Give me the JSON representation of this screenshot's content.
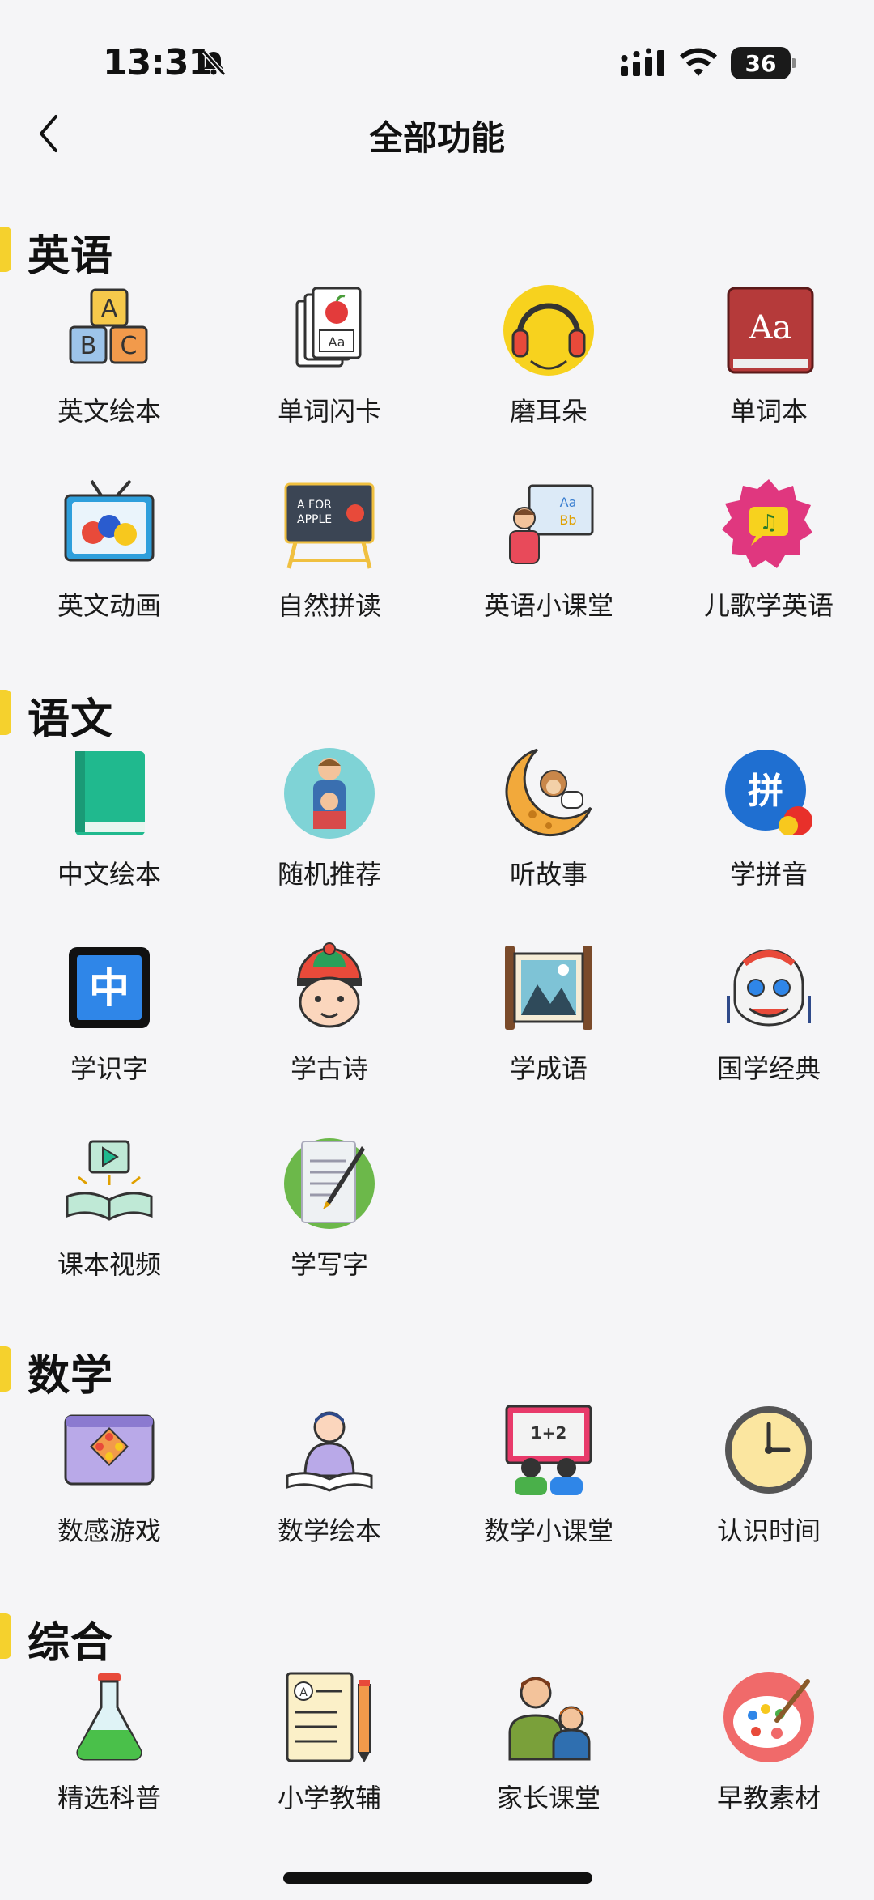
{
  "status_bar": {
    "time": "13:31",
    "battery": "36"
  },
  "nav": {
    "title": "全部功能"
  },
  "sections": {
    "english": {
      "title": "英语",
      "items": [
        {
          "label": "英文绘本",
          "icon": "abc-blocks-icon"
        },
        {
          "label": "单词闪卡",
          "icon": "flashcard-icon"
        },
        {
          "label": "磨耳朵",
          "icon": "headphones-icon"
        },
        {
          "label": "单词本",
          "icon": "dictionary-book-icon"
        },
        {
          "label": "英文动画",
          "icon": "tv-icon"
        },
        {
          "label": "自然拼读",
          "icon": "easel-board-icon"
        },
        {
          "label": "英语小课堂",
          "icon": "teacher-board-icon"
        },
        {
          "label": "儿歌学英语",
          "icon": "music-badge-icon"
        }
      ]
    },
    "chinese": {
      "title": "语文",
      "items": [
        {
          "label": "中文绘本",
          "icon": "green-book-icon"
        },
        {
          "label": "随机推荐",
          "icon": "parent-child-reading-icon"
        },
        {
          "label": "听故事",
          "icon": "moon-monkey-icon"
        },
        {
          "label": "学拼音",
          "icon": "pinyin-badge-icon"
        },
        {
          "label": "学识字",
          "icon": "character-tile-icon"
        },
        {
          "label": "学古诗",
          "icon": "boy-hat-icon"
        },
        {
          "label": "学成语",
          "icon": "scroll-painting-icon"
        },
        {
          "label": "国学经典",
          "icon": "lion-dance-icon"
        },
        {
          "label": "课本视频",
          "icon": "video-book-icon"
        },
        {
          "label": "学写字",
          "icon": "pen-paper-icon"
        }
      ]
    },
    "math": {
      "title": "数学",
      "items": [
        {
          "label": "数感游戏",
          "icon": "math-game-icon"
        },
        {
          "label": "数学绘本",
          "icon": "reader-icon"
        },
        {
          "label": "数学小课堂",
          "icon": "classroom-board-icon"
        },
        {
          "label": "认识时间",
          "icon": "clock-icon"
        }
      ]
    },
    "general": {
      "title": "综合",
      "items": [
        {
          "label": "精选科普",
          "icon": "flask-icon"
        },
        {
          "label": "小学教辅",
          "icon": "worksheet-icon"
        },
        {
          "label": "家长课堂",
          "icon": "parent-child-icon"
        },
        {
          "label": "早教素材",
          "icon": "palette-icon"
        }
      ]
    }
  },
  "colors": {
    "accent": "#f5d12d",
    "background": "#f5f5f7"
  }
}
